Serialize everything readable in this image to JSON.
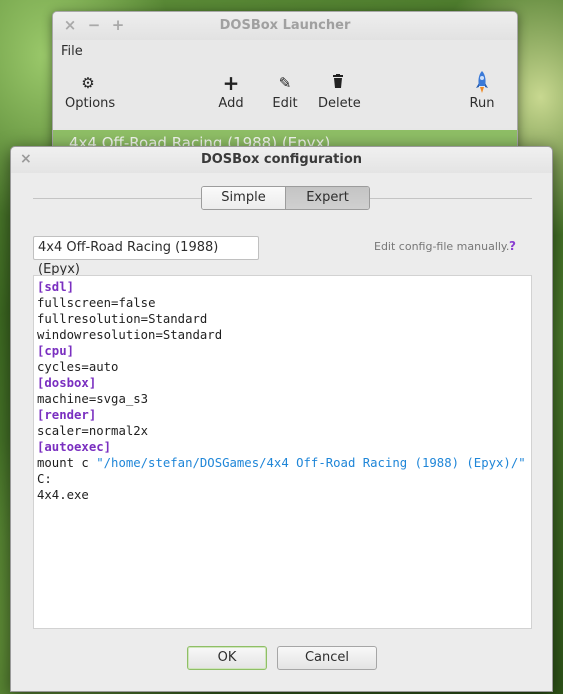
{
  "launcher": {
    "title": "DOSBox Launcher",
    "window_controls": [
      "×",
      "−",
      "+"
    ],
    "menu": [
      "File"
    ],
    "toolbar": {
      "options": {
        "label": "Options",
        "icon": "gear-icon"
      },
      "add": {
        "label": "Add",
        "icon": "plus-icon"
      },
      "edit": {
        "label": "Edit",
        "icon": "pencil-icon"
      },
      "delete": {
        "label": "Delete",
        "icon": "trash-icon"
      },
      "run": {
        "label": "Run",
        "icon": "rocket-icon"
      }
    },
    "selected_game": "4x4 Off-Road Racing (1988) (Epyx)"
  },
  "dialog": {
    "title": "DOSBox configuration",
    "close": "×",
    "tabs": [
      {
        "label": "Simple",
        "active": false
      },
      {
        "label": "Expert",
        "active": true
      }
    ],
    "game_name": "4x4 Off-Road Racing (1988) (Epyx)",
    "edit_manually": "Edit config-file manually.",
    "help": "?",
    "config": [
      {
        "type": "section",
        "text": "[sdl]"
      },
      {
        "type": "kv",
        "key": "fullscreen",
        "value": "false"
      },
      {
        "type": "kv",
        "key": "fullresolution",
        "value": "Standard"
      },
      {
        "type": "kv",
        "key": "windowresolution",
        "value": "Standard"
      },
      {
        "type": "section",
        "text": "[cpu]"
      },
      {
        "type": "kv",
        "key": "cycles",
        "value": "auto"
      },
      {
        "type": "section",
        "text": "[dosbox]"
      },
      {
        "type": "kv",
        "key": "machine",
        "value": "svga_s3"
      },
      {
        "type": "section",
        "text": "[render]"
      },
      {
        "type": "kv",
        "key": "scaler",
        "value": "normal2x"
      },
      {
        "type": "section",
        "text": "[autoexec]"
      },
      {
        "type": "cmd",
        "cmd": "mount c ",
        "arg": "\"/home/stefan/DOSGames/4x4 Off-Road Racing (1988) (Epyx)/\""
      },
      {
        "type": "plain",
        "text": "C:"
      },
      {
        "type": "plain",
        "text": "4x4.exe"
      }
    ],
    "ok_label": "OK",
    "cancel_label": "Cancel"
  },
  "colors": {
    "accent": "#8fbf66",
    "section": "#7a2fc0",
    "string": "#1f86d8",
    "help": "#8a3fd1"
  }
}
